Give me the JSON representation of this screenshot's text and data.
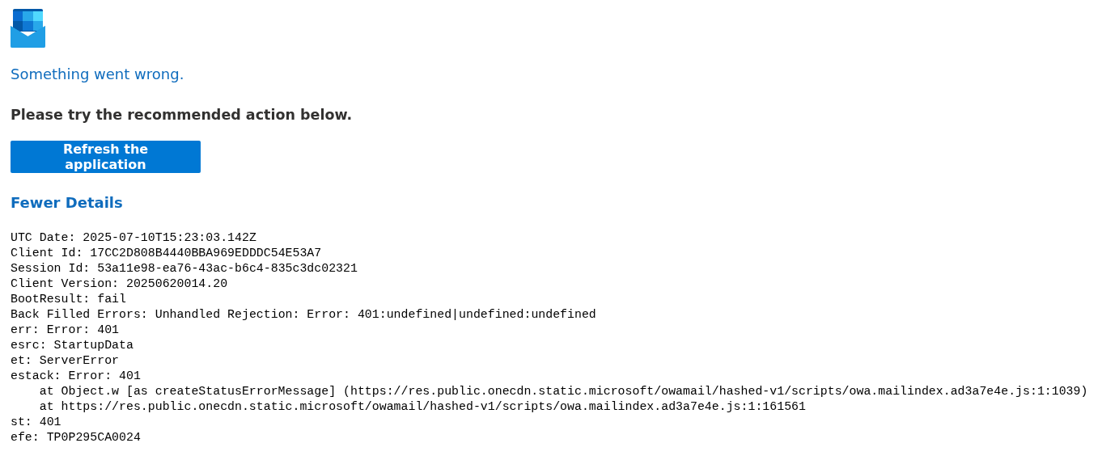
{
  "error": {
    "title": "Something went wrong.",
    "message": "Please try the recommended action below.",
    "action_button": "Refresh the application",
    "details_toggle": "Fewer Details",
    "details": [
      {
        "kind": "line",
        "text": "UTC Date: 2025-07-10T15:23:03.142Z"
      },
      {
        "kind": "line",
        "text": "Client Id: 17CC2D808B4440BBA969EDDDC54E53A7"
      },
      {
        "kind": "line",
        "text": "Session Id: 53a11e98-ea76-43ac-b6c4-835c3dc02321"
      },
      {
        "kind": "line",
        "text": "Client Version: 20250620014.20"
      },
      {
        "kind": "line",
        "text": "BootResult: fail"
      },
      {
        "kind": "line",
        "text": "Back Filled Errors: Unhandled Rejection: Error: 401:undefined|undefined:undefined"
      },
      {
        "kind": "line",
        "text": "err: Error: 401"
      },
      {
        "kind": "line",
        "text": "esrc: StartupData"
      },
      {
        "kind": "line",
        "text": "et: ServerError"
      },
      {
        "kind": "line",
        "text": "estack: Error: 401"
      },
      {
        "kind": "stack",
        "text": "at Object.w [as createStatusErrorMessage] (https://res.public.onecdn.static.microsoft/owamail/hashed-v1/scripts/owa.mailindex.ad3a7e4e.js:1:1039)"
      },
      {
        "kind": "stack",
        "text": "at https://res.public.onecdn.static.microsoft/owamail/hashed-v1/scripts/owa.mailindex.ad3a7e4e.js:1:161561"
      },
      {
        "kind": "line",
        "text": "st: 401"
      },
      {
        "kind": "line",
        "text": "efe: TP0P295CA0024"
      }
    ]
  }
}
